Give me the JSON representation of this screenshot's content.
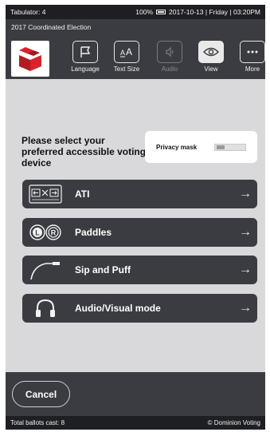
{
  "status_bar": {
    "tabulator": "Tabulator: 4",
    "battery": "100%",
    "datetime": "2017-10-13 | Friday | 03:20PM"
  },
  "header": {
    "election_title": "2017 Coordinated Election",
    "logo_icon": "dominion-logo-icon",
    "tools": [
      {
        "label": "Language",
        "icon": "flag-icon",
        "state": "enabled"
      },
      {
        "label": "Text Size",
        "icon": "text-size-icon",
        "state": "enabled"
      },
      {
        "label": "Audio",
        "icon": "speaker-icon",
        "state": "disabled"
      },
      {
        "label": "View",
        "icon": "eye-icon",
        "state": "active"
      },
      {
        "label": "More",
        "icon": "ellipsis-icon",
        "state": "enabled"
      }
    ]
  },
  "main": {
    "prompt": "Please select your preferred accessible voting device",
    "privacy_mask": {
      "label": "Privacy mask",
      "on": false
    },
    "options": [
      {
        "label": "ATI",
        "icon": "ati-keypad-icon"
      },
      {
        "label": "Paddles",
        "icon": "paddles-icon"
      },
      {
        "label": "Sip and Puff",
        "icon": "sip-puff-icon"
      },
      {
        "label": "Audio/Visual mode",
        "icon": "headphones-icon"
      }
    ],
    "arrow_glyph": "→"
  },
  "footer": {
    "cancel_label": "Cancel"
  },
  "bottom_bar": {
    "ballots_cast": "Total ballots cast: 8",
    "copyright": "© Dominion Voting"
  },
  "colors": {
    "header_bg": "#3a3c41",
    "bar_bg": "#1e1f22",
    "content_bg": "#d9d9dc",
    "brand_red": "#d8232a"
  }
}
